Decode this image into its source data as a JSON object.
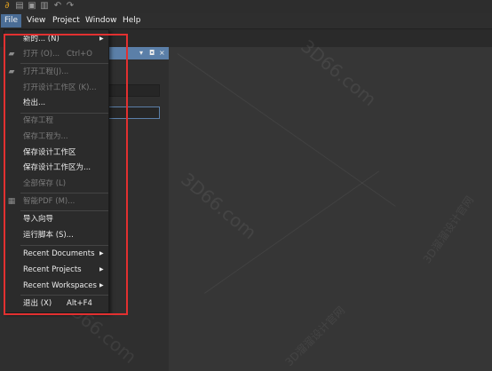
{
  "menubar": {
    "items": [
      {
        "label": "File",
        "active": true
      },
      {
        "label": "View"
      },
      {
        "label": "Project"
      },
      {
        "label": "Window"
      },
      {
        "label": "Help"
      }
    ]
  },
  "file_menu": {
    "items": [
      {
        "label": "新的... (N)",
        "arrow": "▶",
        "enabled": true
      },
      {
        "label": "打开 (O)...",
        "shortcut": "Ctrl+O",
        "enabled": false,
        "icon": "folder-icon"
      },
      {
        "label": "打开工程(J)...",
        "enabled": false,
        "icon": "folder-icon"
      },
      {
        "label": "打开设计工作区 (K)...",
        "enabled": false
      },
      {
        "label": "检出...",
        "enabled": true
      },
      {
        "label": "保存工程",
        "enabled": false
      },
      {
        "label": "保存工程为...",
        "enabled": false
      },
      {
        "label": "保存设计工作区",
        "enabled": true
      },
      {
        "label": "保存设计工作区为...",
        "enabled": true
      },
      {
        "label": "全部保存 (L)",
        "enabled": false
      },
      {
        "label": "智能PDF (M)...",
        "enabled": false,
        "icon": "pdf-icon"
      },
      {
        "label": "导入向导",
        "enabled": true
      },
      {
        "label": "运行脚本 (S)...",
        "enabled": true
      },
      {
        "label": "Recent Documents",
        "arrow": "▶",
        "enabled": true
      },
      {
        "label": "Recent Projects",
        "arrow": "▶",
        "enabled": true
      },
      {
        "label": "Recent Workspaces",
        "arrow": "▶",
        "enabled": true
      },
      {
        "label": "退出 (X)",
        "shortcut": "Alt+F4",
        "enabled": true
      }
    ]
  },
  "panel": {
    "pin_icon": "▾",
    "dock_icon": "◘",
    "close_icon": "×"
  },
  "watermark": {
    "text": "3D66.com",
    "cn_text": "3D溜溜设计官网"
  },
  "colors": {
    "accent": "#4a6d96",
    "panel_header": "#5b7fa8",
    "highlight": "#e23030"
  }
}
